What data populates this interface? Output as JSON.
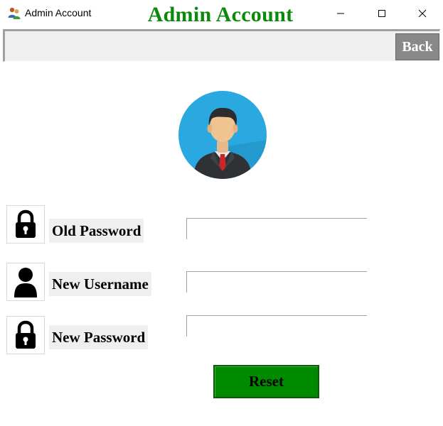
{
  "window": {
    "title": "Admin Account",
    "icon": "admin-users-icon",
    "controls": {
      "minimize": "minimize-icon",
      "maximize": "maximize-icon",
      "close": "close-icon"
    }
  },
  "header": {
    "title": "Admin Account",
    "back_label": "Back",
    "title_color": "#0a8a0a"
  },
  "avatar": {
    "icon": "businessman-avatar-icon",
    "background_color": "#2aa8e0"
  },
  "form": {
    "rows": [
      {
        "label": "Old Password",
        "icon": "lock-icon",
        "value": ""
      },
      {
        "label": "New Username",
        "icon": "user-icon",
        "value": ""
      },
      {
        "label": "New Password",
        "icon": "lock-icon",
        "value": ""
      }
    ],
    "reset_label": "Reset",
    "reset_color": "#008a00"
  }
}
